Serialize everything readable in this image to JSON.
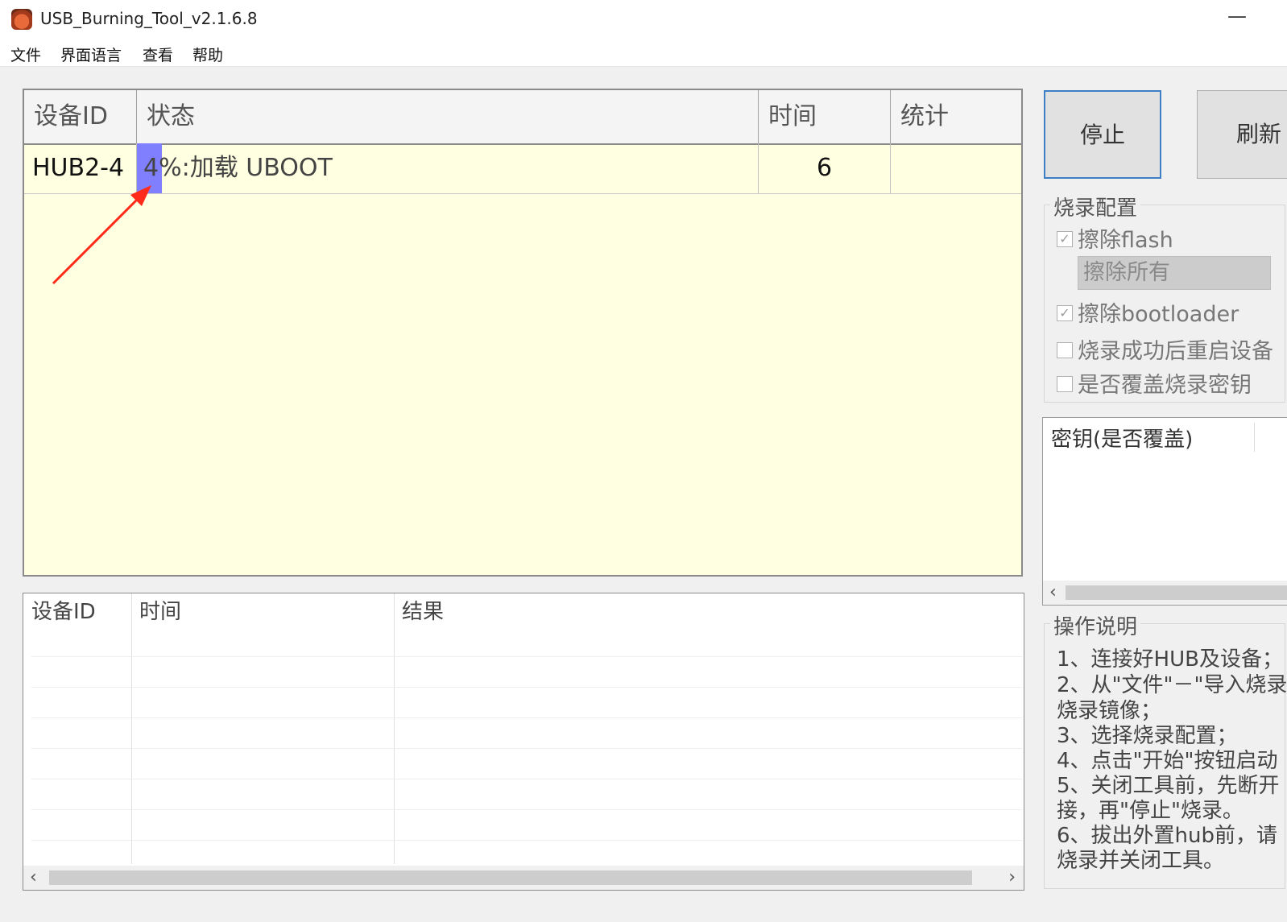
{
  "window": {
    "title": "USB_Burning_Tool_v2.1.6.8",
    "minimize_glyph": "—"
  },
  "menu": [
    "文件",
    "界面语言",
    "查看",
    "帮助"
  ],
  "device_table": {
    "columns": [
      "设备ID",
      "状态",
      "时间",
      "统计"
    ],
    "row": {
      "device_id": "HUB2-4",
      "status": "4%:加载 UBOOT",
      "progress_fraction": 0.04,
      "time": "6",
      "stats": ""
    },
    "background": "#ffffe1",
    "progress_color": "#8080ff",
    "annotation_arrow_color": "#ff2a1a"
  },
  "log_table": {
    "columns": [
      "设备ID",
      "时间",
      "结果"
    ],
    "scroll_left": "‹",
    "scroll_right": "›"
  },
  "buttons": {
    "stop": "停止",
    "refresh": "刷新"
  },
  "burn_config": {
    "title": "烧录配置",
    "erase_flash": {
      "label": "擦除flash",
      "checked": true
    },
    "erase_mode": "擦除所有",
    "erase_bootloader": {
      "label": "擦除bootloader",
      "checked": true
    },
    "reboot_after": {
      "label": "烧录成功后重启设备",
      "checked": false
    },
    "overwrite_key": {
      "label": "是否覆盖烧录密钥",
      "checked": false
    },
    "check_glyph": "✓"
  },
  "key_panel": {
    "header": "密钥(是否覆盖)",
    "scroll_left": "‹"
  },
  "instructions": {
    "title": "操作说明",
    "lines": [
      "1、连接好HUB及设备；",
      "2、从\"文件\"－\"导入烧录",
      "烧录镜像；",
      "3、选择烧录配置；",
      "4、点击\"开始\"按钮启动",
      "5、关闭工具前，先断开",
      "接，再\"停止\"烧录。",
      "6、拔出外置hub前，请",
      "烧录并关闭工具。"
    ]
  }
}
